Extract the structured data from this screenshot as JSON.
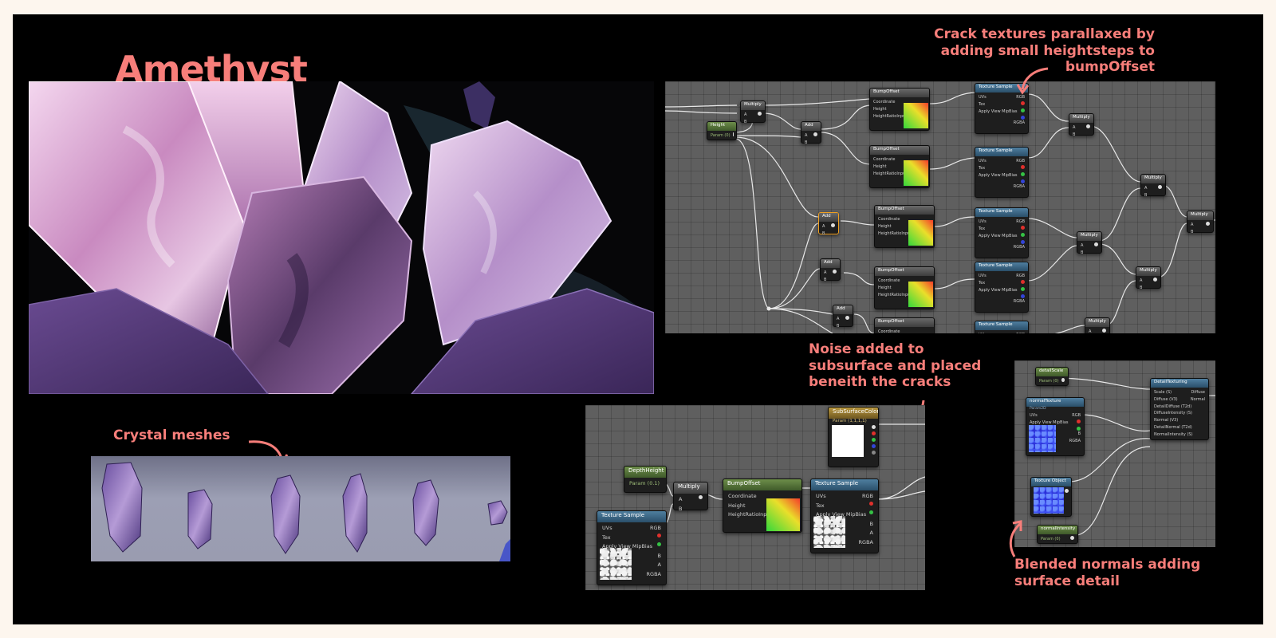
{
  "title": "Amethyst",
  "annotations": {
    "crack": [
      "Crack textures parallaxed by",
      "adding small heightsteps to",
      "bumpOffset"
    ],
    "noise": [
      "Noise added to",
      "subsurface and placed",
      "beneith the cracks"
    ],
    "meshes": "Crystal meshes",
    "normals": [
      "Blended normals adding",
      "surface detail"
    ]
  },
  "colors": {
    "accent": "#f77e7a",
    "board": "#000000",
    "page": "#fdf6ee",
    "graph_bg": "#5f5f5f"
  },
  "graph_main": {
    "height_node": {
      "title": "Height",
      "sub": "Param (0)"
    },
    "multiply_title": "Multiply",
    "add_title": "Add",
    "bump_title": "BumpOffset",
    "bump_pins": [
      "Coordinate",
      "Height",
      "HeightRatioInput"
    ],
    "tex_title": "Texture Sample",
    "tex_in": [
      "UVs",
      "Tex",
      "Apply View MipBias"
    ],
    "tex_out": [
      "RGB",
      "R",
      "G",
      "B",
      "A",
      "RGBA"
    ],
    "ab": [
      "A",
      "B"
    ]
  },
  "graph_sub": {
    "depth": {
      "title": "DepthHeight",
      "sub": "Param (0.1)"
    },
    "multiply": "Multiply",
    "bump": {
      "title": "BumpOffset",
      "pins": [
        "Coordinate",
        "Height",
        "HeightRatioInput"
      ]
    },
    "tex": {
      "title": "Texture Sample",
      "in": [
        "UVs",
        "Tex",
        "Apply View MipBias"
      ],
      "out": [
        "RGB",
        "R",
        "G",
        "B",
        "A",
        "RGBA"
      ]
    },
    "subsurface": {
      "title": "SubSurfaceColor",
      "sub": "Param (1,1,1,1)"
    }
  },
  "graph_detail": {
    "detail_scale": {
      "title": "detailScale",
      "sub": "Param (0)"
    },
    "normal_texture": {
      "title": "normalTexture",
      "sub": "Param2D",
      "in": [
        "UVs",
        "Apply View MipBias"
      ],
      "out": [
        "RGB",
        "R",
        "G",
        "B",
        "A",
        "RGBA"
      ]
    },
    "texture_object": "Texture Object",
    "normal_intensity": {
      "title": "normalIntensity",
      "sub": "Param (0)"
    },
    "detail_texturing": {
      "title": "DetailTexturing",
      "in": [
        "Scale (S)",
        "Diffuse (V3)",
        "DetailDiffuse (T2d)",
        "DiffuseIntensity (S)",
        "Normal (V3)",
        "DetailNormal (T2d)",
        "NormalIntensity (S)"
      ],
      "out": [
        "Diffuse",
        "Normal"
      ]
    }
  }
}
